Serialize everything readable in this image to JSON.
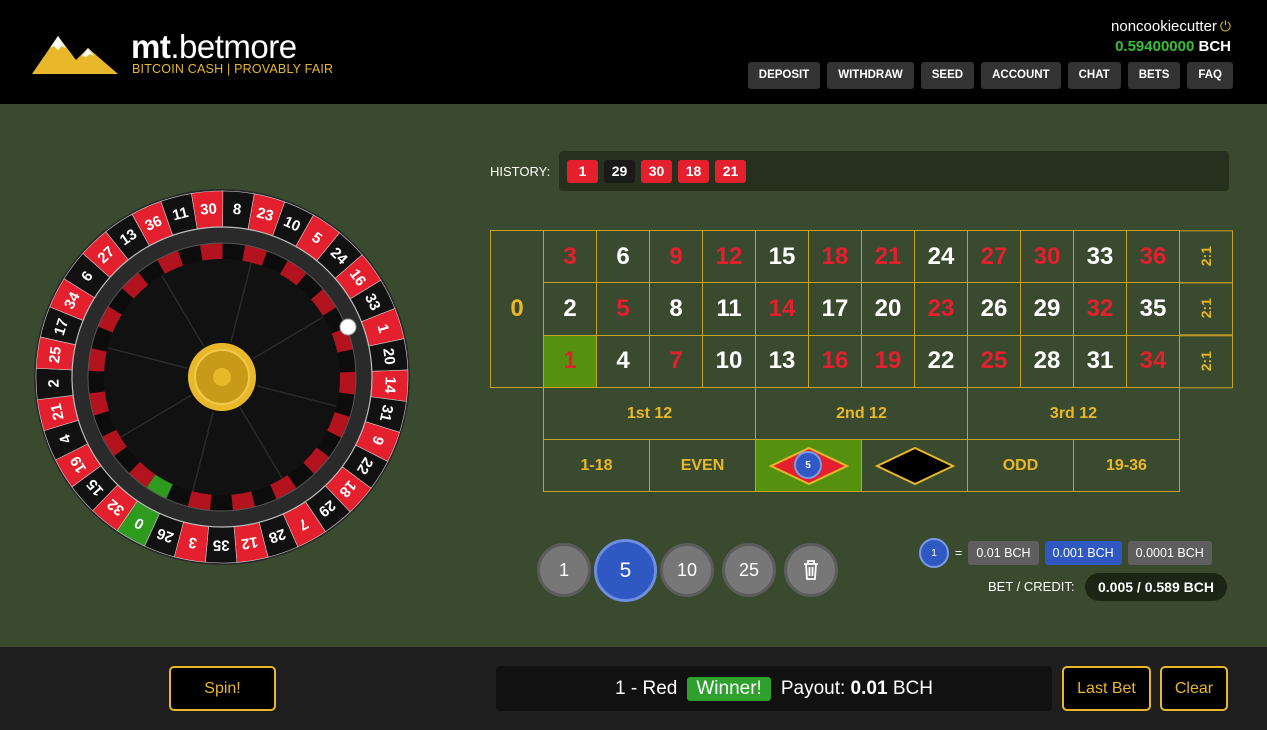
{
  "brand": {
    "name_bold": "mt",
    "name_rest": ".betmore",
    "tagline": "BITCOIN CASH | PROVABLY FAIR"
  },
  "user": {
    "name": "noncookiecutter",
    "balance": "0.59400000",
    "currency": "BCH"
  },
  "nav": [
    "DEPOSIT",
    "WITHDRAW",
    "SEED",
    "ACCOUNT",
    "CHAT",
    "BETS",
    "FAQ"
  ],
  "history": {
    "label": "HISTORY:",
    "items": [
      {
        "n": "1",
        "c": "red"
      },
      {
        "n": "29",
        "c": "black"
      },
      {
        "n": "30",
        "c": "red"
      },
      {
        "n": "18",
        "c": "red"
      },
      {
        "n": "21",
        "c": "red"
      }
    ]
  },
  "board": {
    "zero": "0",
    "rows": [
      [
        {
          "n": "3",
          "c": "red"
        },
        {
          "n": "6",
          "c": "black"
        },
        {
          "n": "9",
          "c": "red"
        },
        {
          "n": "12",
          "c": "red"
        },
        {
          "n": "15",
          "c": "black"
        },
        {
          "n": "18",
          "c": "red"
        },
        {
          "n": "21",
          "c": "red"
        },
        {
          "n": "24",
          "c": "black"
        },
        {
          "n": "27",
          "c": "red"
        },
        {
          "n": "30",
          "c": "red"
        },
        {
          "n": "33",
          "c": "black"
        },
        {
          "n": "36",
          "c": "red"
        }
      ],
      [
        {
          "n": "2",
          "c": "black"
        },
        {
          "n": "5",
          "c": "red"
        },
        {
          "n": "8",
          "c": "black"
        },
        {
          "n": "11",
          "c": "black"
        },
        {
          "n": "14",
          "c": "red"
        },
        {
          "n": "17",
          "c": "black"
        },
        {
          "n": "20",
          "c": "black"
        },
        {
          "n": "23",
          "c": "red"
        },
        {
          "n": "26",
          "c": "black"
        },
        {
          "n": "29",
          "c": "black"
        },
        {
          "n": "32",
          "c": "red"
        },
        {
          "n": "35",
          "c": "black"
        }
      ],
      [
        {
          "n": "1",
          "c": "red",
          "hit": true
        },
        {
          "n": "4",
          "c": "black"
        },
        {
          "n": "7",
          "c": "red"
        },
        {
          "n": "10",
          "c": "black"
        },
        {
          "n": "13",
          "c": "black"
        },
        {
          "n": "16",
          "c": "red"
        },
        {
          "n": "19",
          "c": "red"
        },
        {
          "n": "22",
          "c": "black"
        },
        {
          "n": "25",
          "c": "red"
        },
        {
          "n": "28",
          "c": "black"
        },
        {
          "n": "31",
          "c": "black"
        },
        {
          "n": "34",
          "c": "red"
        }
      ]
    ],
    "column_label": "2:1",
    "dozens": [
      "1st 12",
      "2nd 12",
      "3rd 12"
    ],
    "outside": [
      "1-18",
      "EVEN",
      "",
      "",
      "ODD",
      "19-36"
    ],
    "placed_chip": "5"
  },
  "wheel": {
    "order": [
      "0",
      "32",
      "15",
      "19",
      "4",
      "21",
      "2",
      "25",
      "17",
      "34",
      "6",
      "27",
      "13",
      "36",
      "11",
      "30",
      "8",
      "23",
      "10",
      "5",
      "24",
      "16",
      "33",
      "1",
      "20",
      "14",
      "31",
      "9",
      "22",
      "18",
      "29",
      "7",
      "28",
      "12",
      "35",
      "3",
      "26"
    ],
    "reds": [
      "1",
      "3",
      "5",
      "7",
      "9",
      "12",
      "14",
      "16",
      "18",
      "19",
      "21",
      "23",
      "25",
      "27",
      "30",
      "32",
      "34",
      "36"
    ]
  },
  "chips": [
    "1",
    "5",
    "10",
    "25"
  ],
  "selected_chip": "5",
  "units": {
    "chip": "1",
    "eq": "=",
    "options": [
      "0.01 BCH",
      "0.001 BCH",
      "0.0001 BCH"
    ],
    "active": 1
  },
  "credit": {
    "label": "BET / CREDIT:",
    "value": "0.005 / 0.589 BCH"
  },
  "footer": {
    "spin": "Spin!",
    "result_text": "1 - Red",
    "winner": "Winner!",
    "payout_label": "Payout:",
    "payout_value": "0.01",
    "payout_cur": "BCH",
    "last_bet": "Last Bet",
    "clear": "Clear"
  },
  "colors": {
    "accent": "#e8b82a",
    "red": "#e5202e",
    "green": "#55910f",
    "felt": "#3a4a2e",
    "chip_blue": "#2f58c2"
  }
}
